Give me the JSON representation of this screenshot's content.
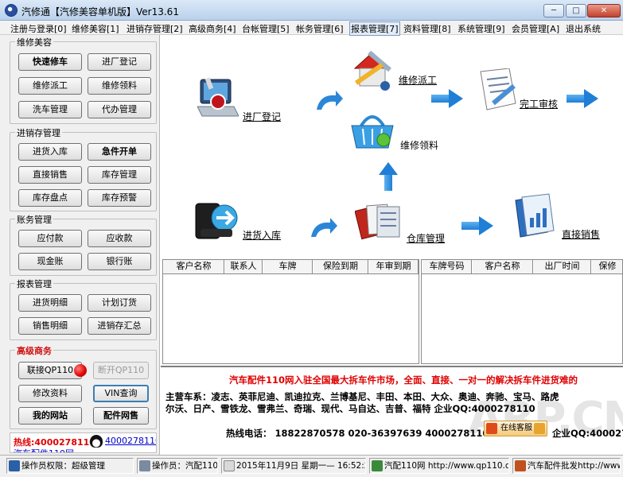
{
  "window": {
    "title": "汽修通【汽修美容单机版】Ver13.61",
    "minimize": "─",
    "maximize": "□",
    "close": "✕"
  },
  "menu": [
    "注册与登录[0]",
    "维修美容[1]",
    "进销存管理[2]",
    "高级商务[4]",
    "台帐管理[5]",
    "帐务管理[6]",
    "报表管理[7]",
    "资料管理[8]",
    "系统管理[9]",
    "会员管理[A]",
    "退出系统"
  ],
  "sidebar": {
    "repair": {
      "title": "维修美容",
      "buttons": [
        "快速修车",
        "进厂登记",
        "维修派工",
        "维修领料",
        "洗车管理",
        "代办管理"
      ]
    },
    "inventory": {
      "title": "进销存管理",
      "buttons": [
        "进货入库",
        "急件开单",
        "直接销售",
        "库存管理",
        "库存盘点",
        "库存预警"
      ]
    },
    "accounts": {
      "title": "账务管理",
      "buttons": [
        "应付款",
        "应收款",
        "现金账",
        "银行账"
      ]
    },
    "reports": {
      "title": "报表管理",
      "buttons": [
        "进货明细",
        "计划订货",
        "销售明细",
        "进销存汇总"
      ]
    },
    "business": {
      "title": "高级商务",
      "connect": "联接QP110",
      "disconnect": "断开QP110",
      "edit_info": "修改资料",
      "vin": "VIN查询",
      "my_site": "我的网站",
      "parts_net": "配件网售"
    },
    "hotline": {
      "label": "热线:4000278110",
      "qq": "4000278110",
      "sub": "汽车配件110网"
    }
  },
  "flow": {
    "entry": "进厂登记",
    "dispatch": "维修派工",
    "finish": "完工审核",
    "materials": "维修领料",
    "stock_in": "进货入库",
    "warehouse": "仓库管理",
    "direct_sale": "直接销售"
  },
  "grid_left": {
    "columns": [
      "客户名称",
      "联系人",
      "车牌",
      "保险到期",
      "年审到期"
    ]
  },
  "grid_right": {
    "columns": [
      "车牌号码",
      "客户名称",
      "出厂时间",
      "保修"
    ]
  },
  "ad": {
    "headline": "汽车配件110网入驻全国最大拆车件市场，全面、直接、一对一的解决拆车件进货难的",
    "brands_line1": "主营车系：凌志、英菲尼迪、凯迪拉克、兰博基尼、丰田、本田、大众、奥迪、奔驰、宝马、路虎",
    "brands_line2": "尔沃、日产、雪铁龙、雪弗兰、奇瑞、现代、马自达、吉普、福特 企业QQ:4000278110",
    "phone": "热线电话： 18822870578 020-36397639 4000278110",
    "online_service": "在线客服",
    "qq": "企业QQ:4000278",
    "watermark": "ARP.CN"
  },
  "status": {
    "permission": "操作员权限：超级管理",
    "operator": "操作员：汽配110网",
    "datetime": "2015年11月9日  星期一— 16:52:26",
    "site": "汽配110网 http://www.qp110.com",
    "ad": "汽车配件批发http://www."
  },
  "colors": {
    "accent_red": "#e00000",
    "link_blue": "#0000cc",
    "arrow_blue": "#1f7fd6"
  }
}
